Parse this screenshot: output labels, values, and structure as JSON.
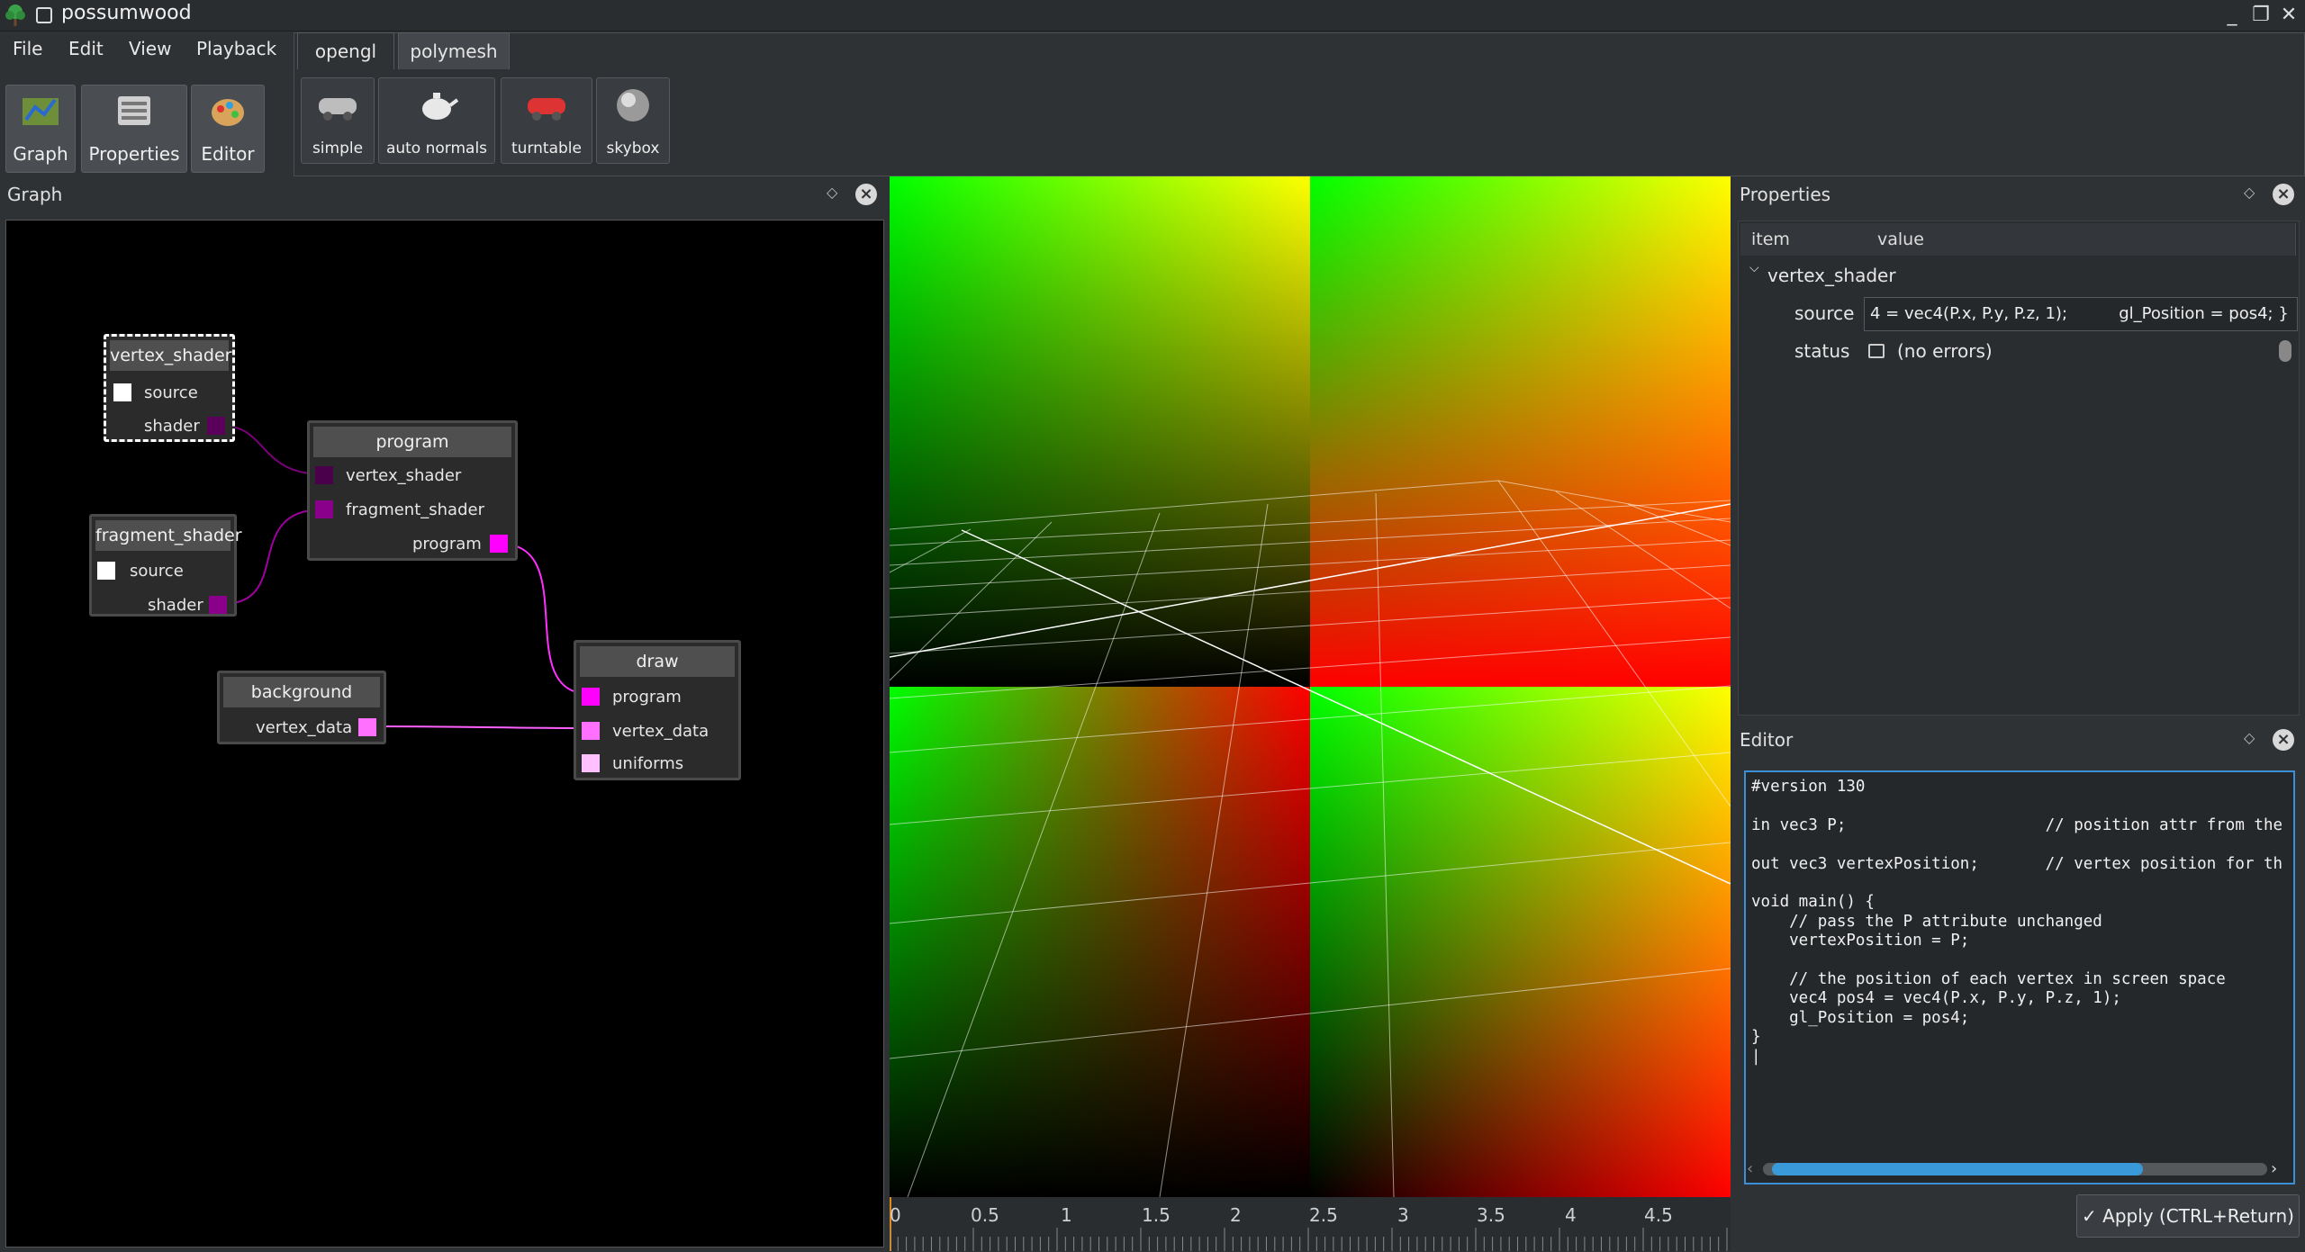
{
  "window": {
    "title": "possumwood",
    "minimize": "_",
    "maximize": "❐",
    "close": "✕"
  },
  "menu": [
    "File",
    "Edit",
    "View",
    "Playback"
  ],
  "toolbar": [
    {
      "label": "Graph",
      "icon": "graph-icon"
    },
    {
      "label": "Properties",
      "icon": "properties-icon"
    },
    {
      "label": "Editor",
      "icon": "editor-icon"
    }
  ],
  "tabs": [
    {
      "label": "opengl",
      "active": false
    },
    {
      "label": "polymesh",
      "active": true
    }
  ],
  "shelf": [
    {
      "label": "simple",
      "icon": "car-icon"
    },
    {
      "label": "auto normals",
      "icon": "teapot-icon"
    },
    {
      "label": "turntable",
      "icon": "red-car-icon"
    },
    {
      "label": "skybox",
      "icon": "sphere-icon"
    }
  ],
  "graph_panel": {
    "title": "Graph",
    "nodes": {
      "vertex_shader": {
        "title": "vertex_shader",
        "ports": [
          "source",
          "shader"
        ]
      },
      "fragment_shader": {
        "title": "fragment_shader",
        "ports": [
          "source",
          "shader"
        ]
      },
      "program": {
        "title": "program",
        "ports": [
          "vertex_shader",
          "fragment_shader",
          "program"
        ]
      },
      "background": {
        "title": "background",
        "ports": [
          "vertex_data"
        ]
      },
      "draw": {
        "title": "draw",
        "ports": [
          "program",
          "vertex_data",
          "uniforms"
        ]
      }
    }
  },
  "timeline": {
    "ticks": [
      "0",
      "0.5",
      "1",
      "1.5",
      "2",
      "2.5",
      "3",
      "3.5",
      "4",
      "4.5"
    ]
  },
  "properties_panel": {
    "title": "Properties",
    "col_item": "item",
    "col_value": "value",
    "group": "vertex_shader",
    "source_label": "source",
    "source_value": "4 = vec4(P.x, P.y, P.z, 1);          gl_Position = pos4; }",
    "status_label": "status",
    "status_value": "(no errors)"
  },
  "editor_panel": {
    "title": "Editor",
    "code": "#version 130\n\nin vec3 P;                     // position attr from the\n\nout vec3 vertexPosition;       // vertex position for th\n\nvoid main() {\n    // pass the P attribute unchanged\n    vertexPosition = P;\n\n    // the position of each vertex in screen space\n    vec4 pos4 = vec4(P.x, P.y, P.z, 1);\n    gl_Position = pos4;\n}\n|",
    "apply_label": "✓ Apply (CTRL+Return)"
  },
  "colors": {
    "accent": "#3a9ad9",
    "port_magenta": "#ff00ff",
    "port_purple": "#8a008a",
    "link": "#ff44ff"
  }
}
